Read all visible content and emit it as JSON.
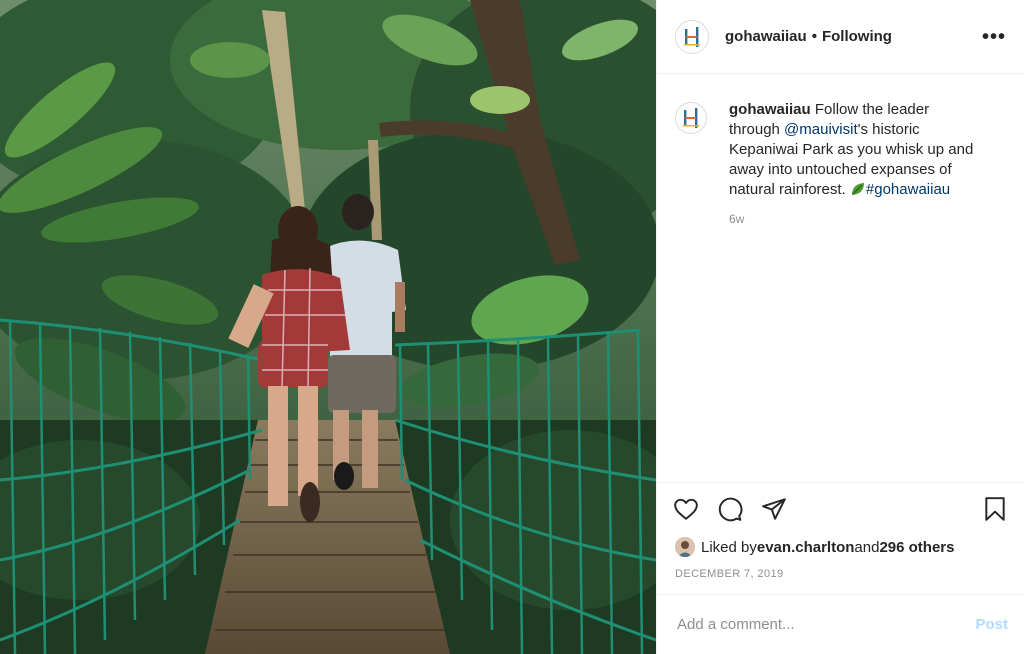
{
  "header": {
    "username": "gohawaiiau",
    "separator": "•",
    "follow_status": "Following",
    "more_label": "•••"
  },
  "caption": {
    "username": "gohawaiiau",
    "text_1": "Follow the leader through ",
    "mention": "@mauivisit",
    "text_2": "'s historic Kepaniwai Park as you whisk up and away into untouched expanses of natural rainforest. ",
    "hashtag": "#gohawaiiau",
    "age": "6w"
  },
  "likes": {
    "prefix": "Liked by ",
    "liker": "evan.charlton",
    "middle": " and ",
    "others": "296 others"
  },
  "date": "DECEMBER 7, 2019",
  "comment": {
    "placeholder": "Add a comment...",
    "post_label": "Post"
  },
  "colors": {
    "link": "#00376b",
    "post_button": "#b3dbff",
    "muted": "#8e8e8e",
    "bridge_net": "#1f8f74"
  }
}
